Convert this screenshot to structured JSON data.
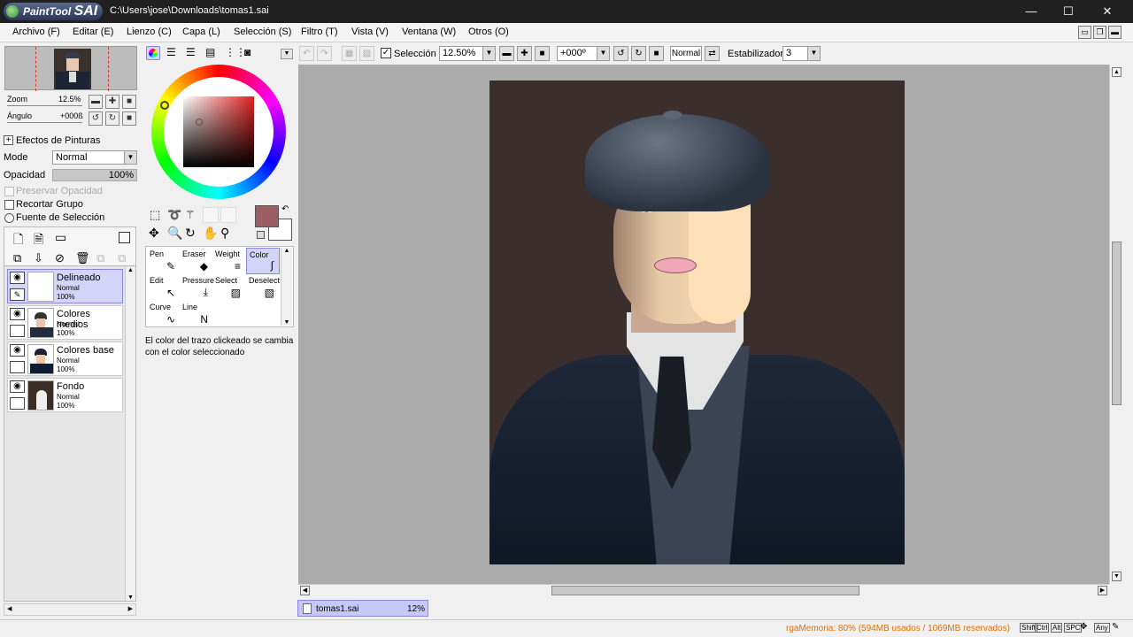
{
  "window": {
    "app_name": "PaintTool",
    "app_name_suffix": "SAI",
    "path": "C:\\Users\\jose\\Downloads\\tomas1.sai",
    "minimize": "—",
    "maximize": "☐",
    "close": "✕"
  },
  "menu": [
    "Archivo (F)",
    "Editar (E)",
    "Lienzo (C)",
    "Capa (L)",
    "Selección (S)",
    "Filtro (T)",
    "Vista (V)",
    "Ventana (W)",
    "Otros (O)"
  ],
  "navigator": {
    "zoom_label": "Zoom",
    "zoom_value": "12.5%",
    "angle_label": "Ángulo",
    "angle_value": "+000ß"
  },
  "effects": {
    "title": "Efectos de Pinturas",
    "mode_label": "Mode",
    "mode_value": "Normal",
    "opacity_label": "Opacidad",
    "opacity_value": "100%",
    "preserve_opacity": "Preservar Opacidad",
    "clip_group": "Recortar Grupo",
    "selection_source": "Fuente de Selección"
  },
  "layers": [
    {
      "name": "Delineado",
      "mode": "Normal",
      "opacity": "100%",
      "selected": true
    },
    {
      "name": "Colores medios",
      "mode": "Normal",
      "opacity": "100%",
      "selected": false
    },
    {
      "name": "Colores base",
      "mode": "Normal",
      "opacity": "100%",
      "selected": false
    },
    {
      "name": "Fondo",
      "mode": "Normal",
      "opacity": "100%",
      "selected": false
    }
  ],
  "colors": {
    "primary": "#9a5e63",
    "secondary": "#ffffff",
    "wheel_hue": "#e02020"
  },
  "tools": [
    {
      "label": "Pen",
      "glyph": "✎"
    },
    {
      "label": "Eraser",
      "glyph": "◆"
    },
    {
      "label": "Weight",
      "glyph": "≡"
    },
    {
      "label": "Color",
      "glyph": "∫"
    },
    {
      "label": "Edit",
      "glyph": "↖"
    },
    {
      "label": "Pressure",
      "glyph": "⤓"
    },
    {
      "label": "Select",
      "glyph": "▨"
    },
    {
      "label": "Deselect",
      "glyph": "▧"
    },
    {
      "label": "Curve",
      "glyph": "∿"
    },
    {
      "label": "Line",
      "glyph": "N"
    }
  ],
  "tool_hint": "El color del trazo clickeado se cambia con el color seleccionado",
  "toolbar": {
    "selection_label": "Selección",
    "zoom_value": "12.50%",
    "angle_value": "+000º",
    "blend_mode": "Normal",
    "stabilizer_label": "Estabilizador",
    "stabilizer_value": "3"
  },
  "tab": {
    "name": "tomas1.sai",
    "zoom": "12%"
  },
  "status": {
    "memory": "rgaMemoria: 80% (594MB usados / 1069MB reservados)",
    "keys": [
      "Shift",
      "Ctrl",
      "Alt",
      "SPC",
      "✥",
      "Any",
      "✎"
    ]
  }
}
